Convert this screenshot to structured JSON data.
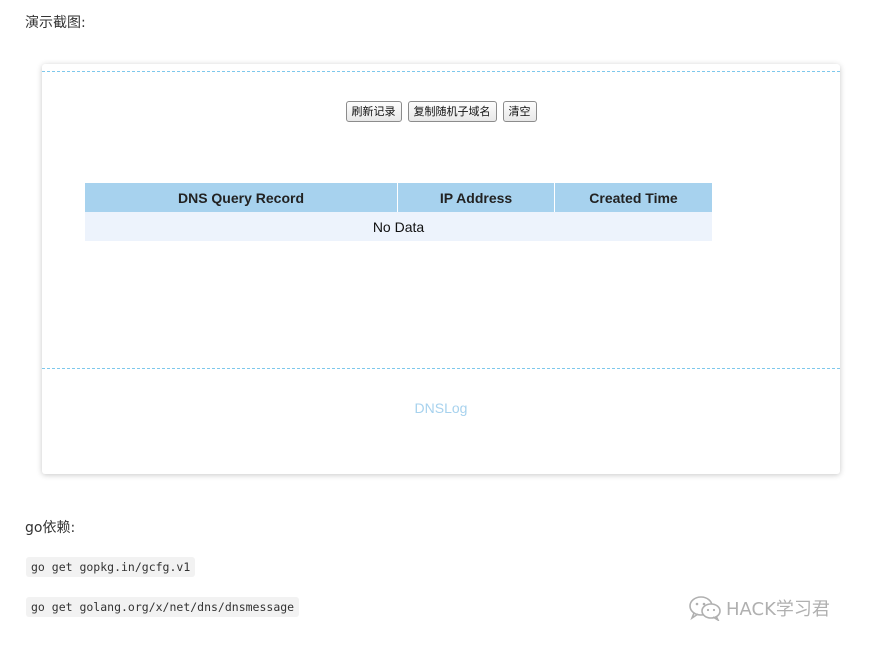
{
  "intro_label": "演示截图:",
  "demo": {
    "toolbar": {
      "refresh_label": "刷新记录",
      "copy_label": "复制随机子域名",
      "clear_label": "清空"
    },
    "table": {
      "headers": [
        "DNS Query Record",
        "IP Address",
        "Created Time"
      ],
      "empty_text": "No Data"
    },
    "footer_brand": "DNSLog"
  },
  "deps_label": "go依赖:",
  "code_lines": [
    "go get gopkg.in/gcfg.v1",
    "go get golang.org/x/net/dns/dnsmessage"
  ],
  "watermark": {
    "icon": "wechat-icon",
    "text": "HACK学习君"
  },
  "colors": {
    "accent": "#a7d2ee",
    "row_bg": "#edf3fc",
    "dash": "#7ec8ec"
  }
}
